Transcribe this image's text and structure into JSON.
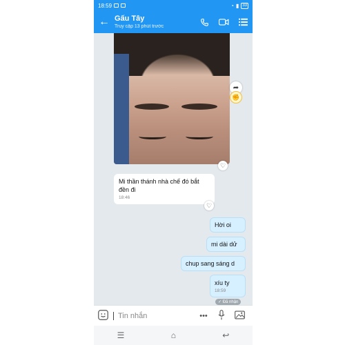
{
  "status": {
    "time": "18:59",
    "battery": "33"
  },
  "header": {
    "title": "Gấu Tây",
    "subtitle": "Truy cập 13 phút trước"
  },
  "messages": {
    "incoming": {
      "text": "Mi thần thánh nhà chế đó bắt đền đi",
      "time": "18:46"
    },
    "outgoing": [
      {
        "text": "Hời oi"
      },
      {
        "text": "mi dài dử"
      },
      {
        "text": "chup sang sáng d"
      },
      {
        "text": "xíu ty",
        "time": "18:59"
      }
    ],
    "seen_label": "✓ Đã nhận"
  },
  "input": {
    "placeholder": "Tin nhắn"
  },
  "colors": {
    "accent": "#2196f3",
    "outgoing_bubble": "#d7f0ff",
    "background": "#e4e9ee"
  },
  "icons": [
    "back-arrow-icon",
    "phone-icon",
    "video-call-icon",
    "menu-icon",
    "share-icon",
    "reaction-icon",
    "heart-icon",
    "sticker-icon",
    "more-icon",
    "mic-icon",
    "image-icon"
  ]
}
